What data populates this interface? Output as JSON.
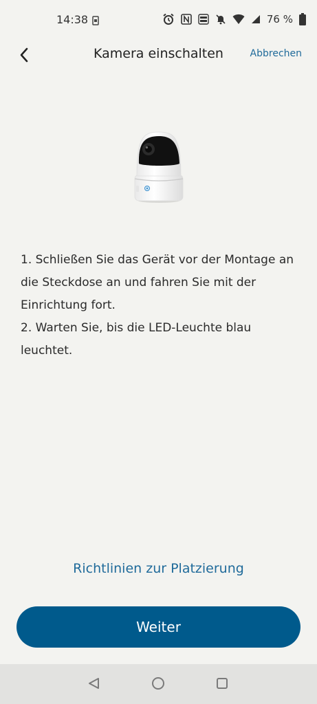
{
  "status_bar": {
    "time": "14:38",
    "battery_percent": "76 %",
    "icons": [
      "sim-card-icon",
      "alarm-icon",
      "nfc-icon",
      "volte-icon",
      "mute-icon",
      "wifi-icon",
      "signal-icon",
      "battery-icon"
    ]
  },
  "header": {
    "title": "Kamera einschalten",
    "cancel_label": "Abbrechen",
    "back_icon": "chevron-left-icon"
  },
  "device_image": "indoor-pan-tilt-camera",
  "instructions": {
    "step1": "1. Schließen Sie das Gerät vor der Montage an die Steckdose an und fahren Sie mit der Einrichtung fort.",
    "step2": "2. Warten Sie, bis die LED-Leuchte blau leuchtet."
  },
  "guide_link": "Richtlinien zur Platzierung",
  "continue_label": "Weiter",
  "colors": {
    "background": "#f3f3f0",
    "accent": "#005a8c",
    "link": "#1f6a9a",
    "nav_bar": "#e2e2e0"
  },
  "nav_bar": {
    "icons": [
      "back-triangle-icon",
      "home-circle-icon",
      "recents-square-icon"
    ]
  }
}
